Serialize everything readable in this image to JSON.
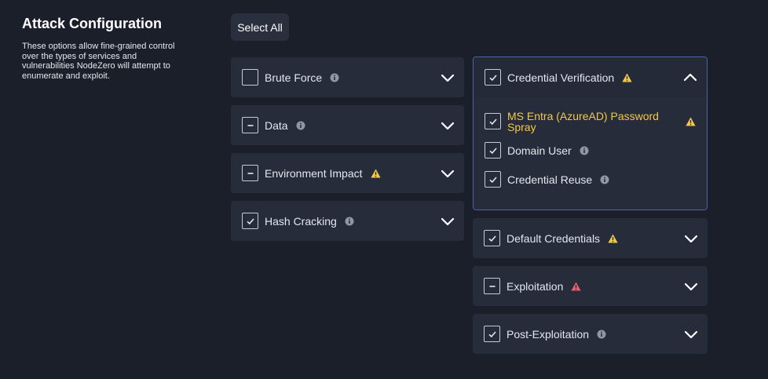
{
  "intro": {
    "title": "Attack Configuration",
    "description": "These options allow fine-grained control over the types of services and vulnerabilities NodeZero will attempt to enumerate and exploit."
  },
  "toolbar": {
    "select_all_label": "Select All"
  },
  "colors": {
    "background": "#1b1f2a",
    "card": "#272c3b",
    "info": "#8f96a6",
    "warning": "#f3c945",
    "danger": "#e0606f",
    "focus_border": "#4b63a8"
  },
  "left_column": [
    {
      "label": "Brute Force",
      "state": "unchecked",
      "badge": "info-icon"
    },
    {
      "label": "Data",
      "state": "indeterminate",
      "badge": "info-icon"
    },
    {
      "label": "Environment Impact",
      "state": "indeterminate",
      "badge": "warning-icon"
    },
    {
      "label": "Hash Cracking",
      "state": "checked",
      "badge": "info-icon"
    }
  ],
  "right_column": [
    {
      "label": "Credential Verification",
      "state": "checked",
      "badge": "warning-icon",
      "expanded": true,
      "items": [
        {
          "label": "MS Entra (AzureAD) Password Spray",
          "state": "checked",
          "badge": "warning-icon"
        },
        {
          "label": "Domain User",
          "state": "checked",
          "badge": "info-icon"
        },
        {
          "label": "Credential Reuse",
          "state": "checked",
          "badge": "info-icon"
        }
      ]
    },
    {
      "label": "Default Credentials",
      "state": "checked",
      "badge": "warning-icon"
    },
    {
      "label": "Exploitation",
      "state": "indeterminate",
      "badge": "danger-icon"
    },
    {
      "label": "Post-Exploitation",
      "state": "checked",
      "badge": "info-icon"
    }
  ]
}
